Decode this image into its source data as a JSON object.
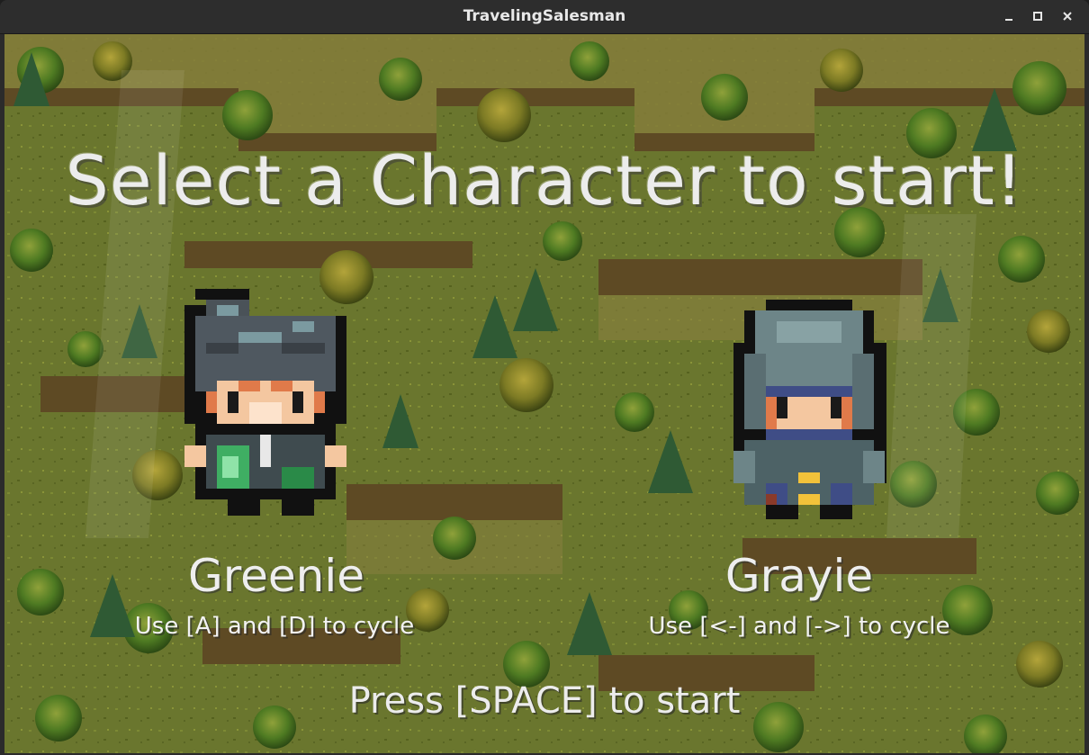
{
  "window": {
    "title": "TravelingSalesman",
    "controls": [
      "minimize-icon",
      "maximize-icon",
      "close-icon"
    ]
  },
  "screen": {
    "headline": "Select a Character to start!",
    "start_hint": "Press [SPACE] to start"
  },
  "characters": [
    {
      "name": "Greenie",
      "hint": "Use [A] and [D] to cycle",
      "accent": "#3fae63"
    },
    {
      "name": "Grayie",
      "hint": "Use [<-] and [->] to cycle",
      "accent": "#6d8c8c"
    }
  ],
  "colors": {
    "grass": "#6b7a2c",
    "cliff": "#7a6a3a",
    "tree_green": "#3f7a2a",
    "text": "#ececec"
  }
}
